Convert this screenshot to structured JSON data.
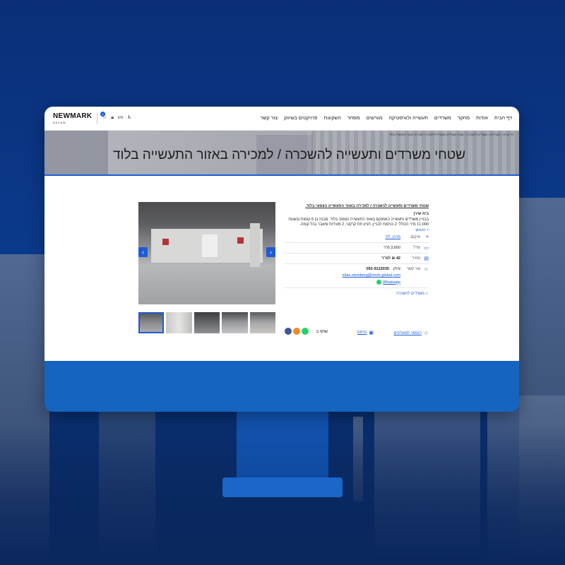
{
  "header": {
    "logo_main": "NEWMARK",
    "logo_sub": "NATAM",
    "lang": "EN",
    "favorites_count": "0",
    "nav": [
      "דף הבית",
      "אודות",
      "מחקר",
      "משרדים",
      "תעשייה ולוגיסטיקה",
      "מגרשים",
      "מסחר",
      "השקעות",
      "פרויקטים בשיווק",
      "צור קשר"
    ]
  },
  "hero": {
    "breadcrumb": "דף הבית > משרדים > משרדים להשכרה > שטחי משרדים ותעשייה להשכרה / למכירה באזור התעשייה בלוד",
    "title": "שטחי משרדים ותעשייה להשכרה / למכירה באזור התעשייה בלוד"
  },
  "listing": {
    "title": "שטחי משרדים ותעשייה להשכרה / למכירה באזור התעשייה הצפוני בלוד.",
    "building": "בית שירן",
    "description": "בבניין משרדים ותעשייה הממוקם באזור התעשייה הצפוני בלוד. מבנה בן 6 קומות ובשטח 11,000 מ\"ר הכולל: 2 כניסות לבניין, חניון תת קרקעי, 2 מעליות ומעבר בכל קומה.",
    "read_more": "+ להמשך",
    "location_label": "מיקום",
    "location_value": "מרכז, לוד",
    "size_label": "גודל",
    "size_value": "3,650 מ\"ר",
    "price_label": "מחיר",
    "price_value": "42 ₪ למ\"ר",
    "contact_label": "צור קשר",
    "contact_name": "איתן",
    "contact_phone": "052-9122035",
    "contact_email": "eitan.steinberg@nmrk-global.com",
    "whatsapp": "Whatsapp",
    "category_tag": "✓ משרדים להשכרה",
    "add_favorites": "הוספה למועדפים",
    "print": "הדפס",
    "share": "שתף ב:"
  },
  "colors": {
    "accent": "#1e5bd6",
    "monitor": "#1565c0"
  }
}
